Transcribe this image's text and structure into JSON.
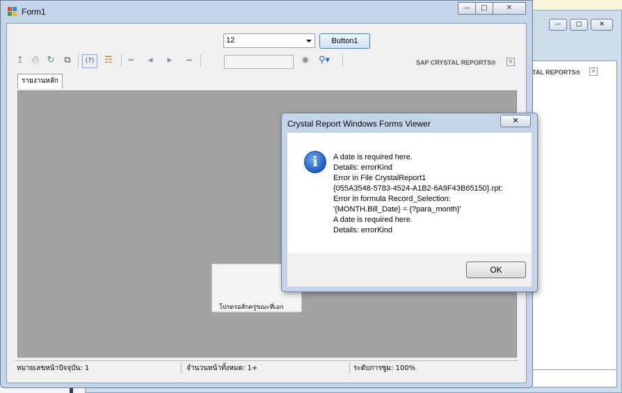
{
  "background_window": {
    "brand": "TAL REPORTS®"
  },
  "window": {
    "title": "Form1",
    "controls": {
      "minimize": "—",
      "maximize": "□",
      "close": "✕"
    }
  },
  "form": {
    "combo_value": "12",
    "button_label": "Button1"
  },
  "toolbar": {
    "brand": "SAP CRYSTAL REPORTS®",
    "page_value": "",
    "icons": [
      "export-icon",
      "print-icon",
      "refresh-icon",
      "copy-icon",
      "help-icon",
      "group-tree-icon",
      "first-page-icon",
      "prev-page-icon",
      "next-page-icon",
      "last-page-icon",
      "find-icon",
      "zoom-icon"
    ]
  },
  "tab": {
    "label": "รายงานหลัก"
  },
  "loading": {
    "text": "โปรดรอสักครู่ขณะที่เอก"
  },
  "status": {
    "current_page": "หมายเลขหน้าปัจจุบัน: 1",
    "total_pages": "จำนวนหน้าทั้งหมด: 1+",
    "zoom": "ระดับการซูม: 100%"
  },
  "dialog": {
    "title": "Crystal Report Windows Forms Viewer",
    "close": "✕",
    "icon": "information-icon",
    "lines": [
      "A date is required here.",
      "Details: errorKind",
      "Error in File CrystalReport1",
      "{055A3548-5783-4524-A1B2-6A9F43B65150}.rpt:",
      "Error in formula  Record_Selection:",
      "'{MONTH.Bill_Date} = {?para_month}'",
      "A date is required here.",
      "Details: errorKind"
    ],
    "ok_label": "OK"
  },
  "colors": {
    "window_frame": "#c4d5ea",
    "viewer_bg": "#a3a3a3",
    "info_blue": "#1f5cc2"
  }
}
